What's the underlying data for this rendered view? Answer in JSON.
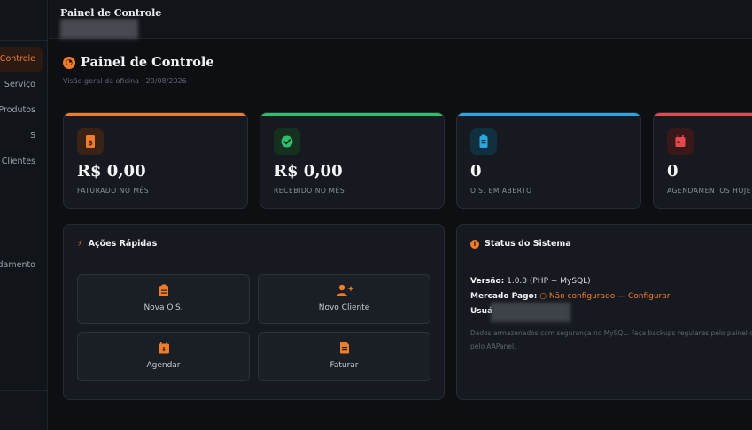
{
  "sidebar": {
    "items": [
      {
        "label": "Painel de Controle",
        "active": true
      },
      {
        "label": "Serviço"
      },
      {
        "label": "Produtos"
      },
      {
        "label": "S"
      },
      {
        "label": "Clientes"
      },
      {
        "label": "Agendamento"
      }
    ]
  },
  "topbar": {
    "title": "Painel de Controle"
  },
  "header": {
    "icon": "gauge-icon",
    "title": "Painel de Controle",
    "subtitle": "Visão geral da oficina · 29/08/2026"
  },
  "stats": [
    {
      "value": "R$ 0,00",
      "label": "FATURADO NO MÊS",
      "icon": "invoice-dollar-icon",
      "color": "#f07c2a",
      "icon_bg": "#3a2314"
    },
    {
      "value": "R$ 0,00",
      "label": "RECEBIDO NO MÊS",
      "icon": "check-circle-icon",
      "color": "#2fbf6a",
      "icon_bg": "#15301f"
    },
    {
      "value": "0",
      "label": "O.S. EM ABERTO",
      "icon": "clipboard-icon",
      "color": "#2aa7e0",
      "icon_bg": "#10303f"
    },
    {
      "value": "0",
      "label": "AGENDAMENTOS HOJE",
      "icon": "calendar-icon",
      "color": "#e5484d",
      "icon_bg": "#3a1719"
    }
  ],
  "quick_actions": {
    "title": "Ações Rápidas",
    "icon": "bolt-icon",
    "items": [
      {
        "label": "Nova O.S.",
        "icon": "clipboard-icon"
      },
      {
        "label": "Novo Cliente",
        "icon": "user-plus-icon"
      },
      {
        "label": "Agendar",
        "icon": "calendar-plus-icon"
      },
      {
        "label": "Faturar",
        "icon": "invoice-icon"
      }
    ]
  },
  "system_status": {
    "title": "Status do Sistema",
    "icon": "info-circle-icon",
    "version_label": "Versão:",
    "version_value": "1.0.0 (PHP + MySQL)",
    "payment_label": "Mercado Pago:",
    "payment_status": "○ Não configurado",
    "payment_sep": "—",
    "payment_link": "Configurar",
    "user_label": "Usuá",
    "note": "Dados armazenados com segurança no MySQL. Faça backups regulares pelo painel ou pelo AAPanel."
  }
}
